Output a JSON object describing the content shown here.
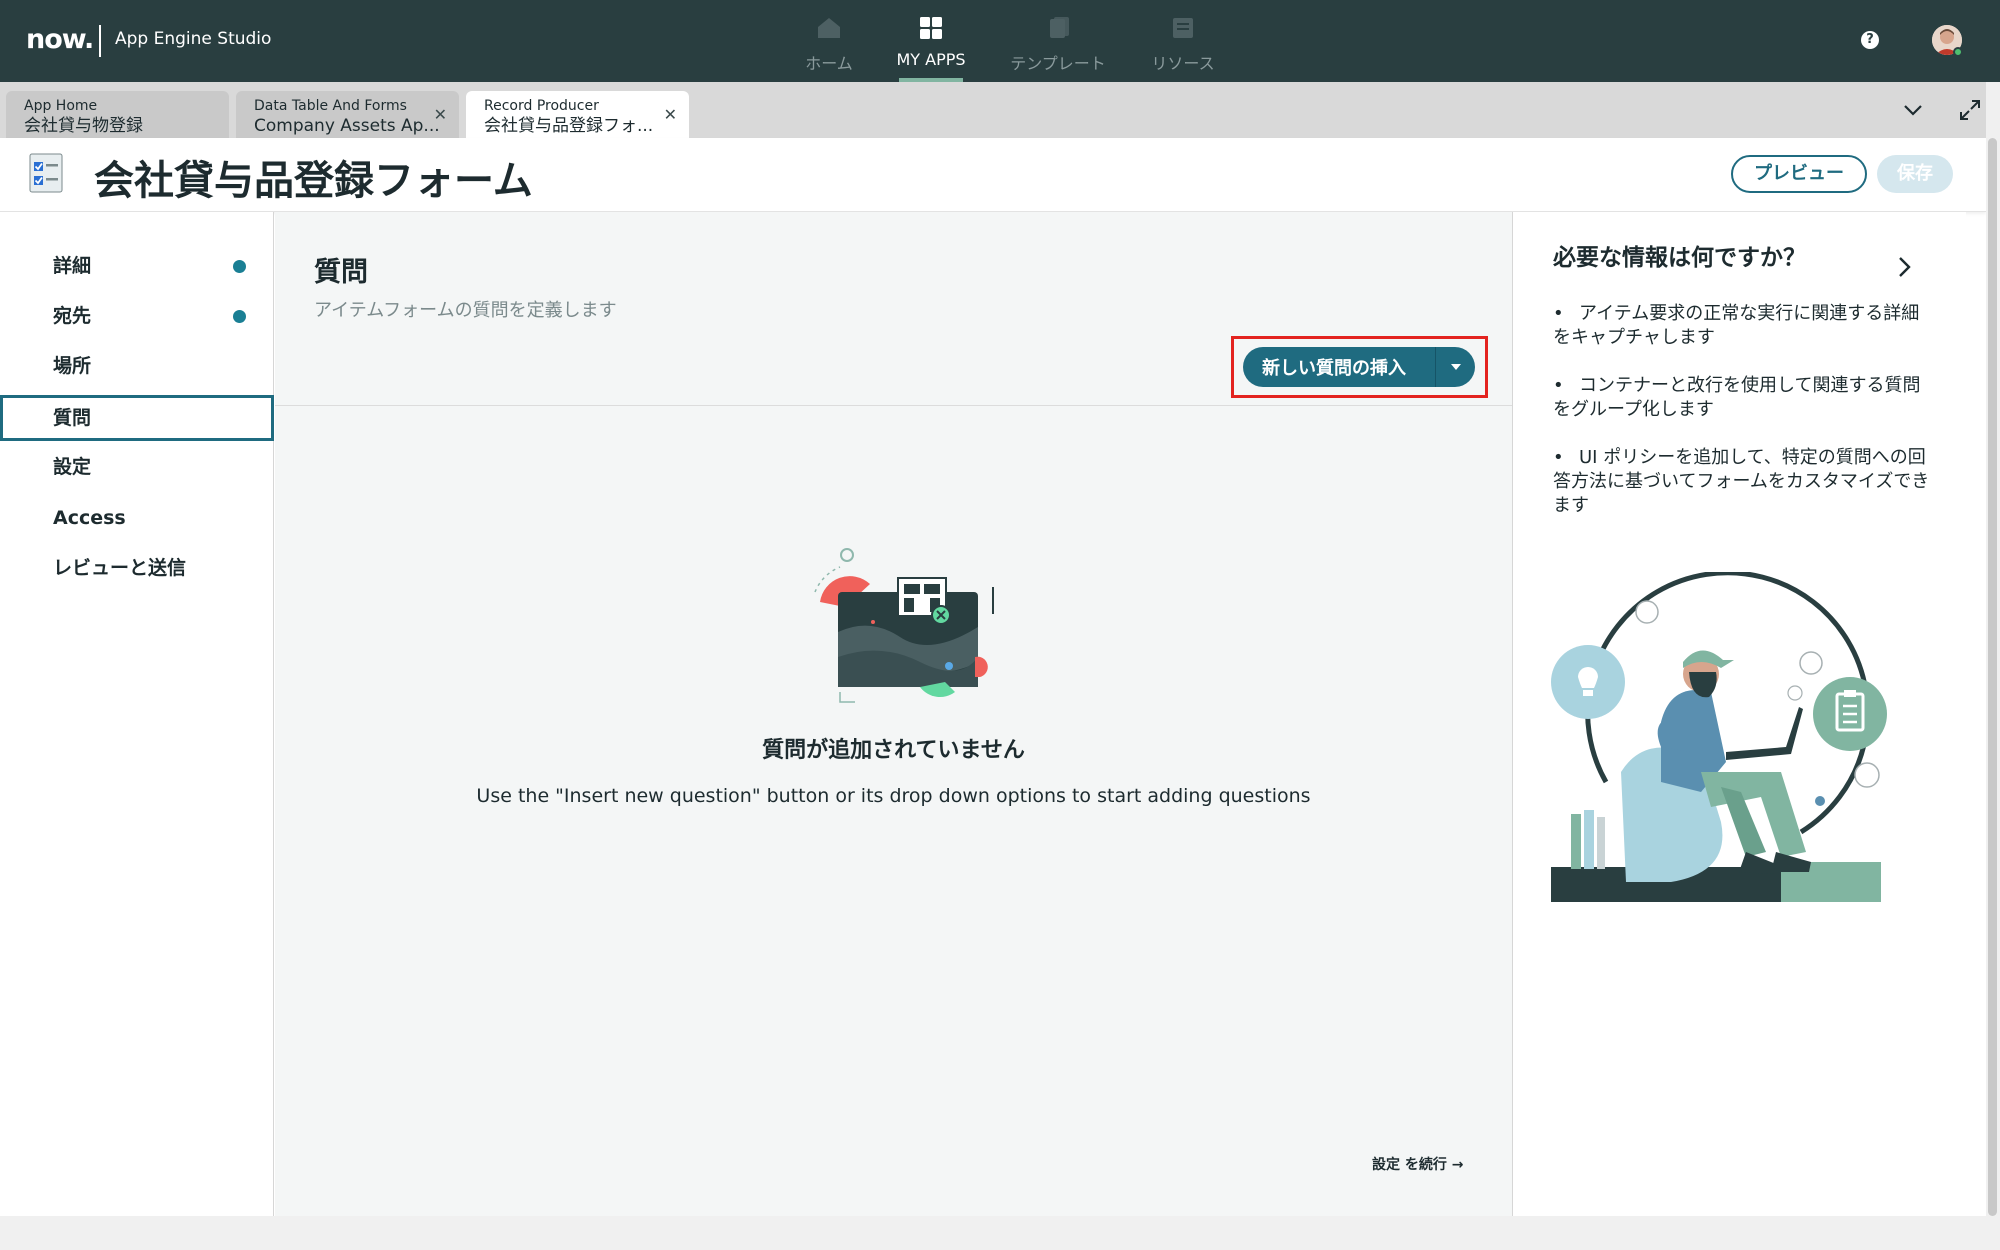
{
  "topbar": {
    "logo": "now.",
    "app_name": "App Engine Studio",
    "nav": [
      {
        "label": "ホーム",
        "icon": "home-icon",
        "active": false
      },
      {
        "label": "MY APPS",
        "icon": "apps-grid-icon",
        "active": true
      },
      {
        "label": "テンプレート",
        "icon": "templates-icon",
        "active": false
      },
      {
        "label": "リソース",
        "icon": "resources-icon",
        "active": false
      }
    ],
    "help": "?"
  },
  "tabs": [
    {
      "type": "App Home",
      "title": "会社貸与物登録",
      "closable": false,
      "active": false
    },
    {
      "type": "Data Table And Forms",
      "title": "Company Assets Ap...",
      "closable": true,
      "active": false
    },
    {
      "type": "Record Producer",
      "title": "会社貸与品登録フォ...",
      "closable": true,
      "active": true
    }
  ],
  "header": {
    "title": "会社貸与品登録フォーム",
    "preview_label": "プレビュー",
    "save_label": "保存"
  },
  "sidebar": {
    "items": [
      {
        "label": "詳細",
        "completed": true,
        "active": false
      },
      {
        "label": "宛先",
        "completed": true,
        "active": false
      },
      {
        "label": "場所",
        "completed": false,
        "active": false
      },
      {
        "label": "質問",
        "completed": false,
        "active": true
      },
      {
        "label": "設定",
        "completed": false,
        "active": false
      },
      {
        "label": "Access",
        "completed": false,
        "active": false
      },
      {
        "label": "レビューと送信",
        "completed": false,
        "active": false
      }
    ]
  },
  "main": {
    "title": "質問",
    "description": "アイテムフォームの質問を定義します",
    "insert_button_label": "新しい質問の挿入",
    "empty_title": "質問が追加されていません",
    "empty_description": "Use the \"Insert new question\" button or its drop down options to start adding questions",
    "continue_label": "設定 を続行 →"
  },
  "help_panel": {
    "title": "必要な情報は何ですか？",
    "items": [
      "アイテム要求の正常な実行に関連する詳細をキャプチャします",
      "コンテナーと改行を使用して関連する質問をグループ化します",
      "UI ポリシーを追加して、特定の質問への回答方法に基づいてフォームをカスタマイズできます"
    ]
  },
  "colors": {
    "topbar": "#293e40",
    "accent": "#1f6b80",
    "highlight": "#e3231f",
    "completed_dot": "#1a7f94"
  }
}
